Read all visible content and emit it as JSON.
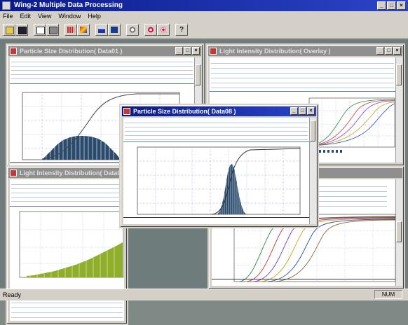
{
  "app": {
    "title": "Wing-2 Multiple Data Processing",
    "status": "Ready",
    "num_indicator": "NUM"
  },
  "menu": [
    "File",
    "Edit",
    "View",
    "Window",
    "Help"
  ],
  "toolbar_icons": [
    "open-file-icon",
    "save-icon",
    "copy-icon",
    "print-icon",
    "table-icon",
    "palette-icon",
    "bar-chart-icon",
    "chart-overlay-icon",
    "gear-icon",
    "target-icon",
    "target-alt-icon",
    "help-icon"
  ],
  "windows": {
    "psd01": {
      "title": "Particle Size Distribution( Data01 )"
    },
    "lid_overlay": {
      "title": "Light Intensity Distribution( Overlay )"
    },
    "lid_left": {
      "title": "Light Intensity Distribution( Data0"
    },
    "psd08": {
      "title": "Particle Size Distribution( Data08 )"
    }
  },
  "colors": {
    "accent": "#0a1a8a",
    "histogram": "#2a4a6e",
    "curve": "#444444",
    "bars_green": "#8fae2a"
  }
}
